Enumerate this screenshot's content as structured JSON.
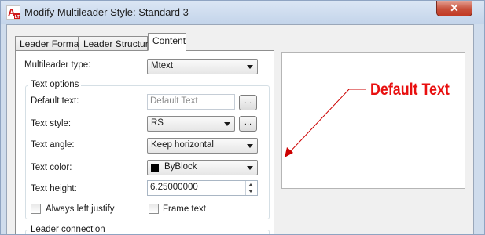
{
  "window": {
    "title": "Modify Multileader Style: Standard 3",
    "close_glyph": "✕",
    "app_icon": "autocad-lt-icon",
    "app_icon_text": "A"
  },
  "tabs": [
    {
      "label": "Leader Format",
      "active": false
    },
    {
      "label": "Leader Structure",
      "active": false
    },
    {
      "label": "Content",
      "active": true
    }
  ],
  "content": {
    "multileader_type": {
      "label": "Multileader type:",
      "value": "Mtext"
    },
    "text_options": {
      "title": "Text options",
      "default_text": {
        "label": "Default text:",
        "value": "Default Text",
        "button": "..."
      },
      "text_style": {
        "label": "Text style:",
        "value": "RS",
        "button": "..."
      },
      "text_angle": {
        "label": "Text angle:",
        "value": "Keep horizontal"
      },
      "text_color": {
        "label": "Text color:",
        "value": "ByBlock",
        "swatch": "#000000"
      },
      "text_height": {
        "label": "Text height:",
        "value": "6.25000000"
      },
      "always_left_justify": {
        "label": "Always left justify",
        "checked": false
      },
      "frame_text": {
        "label": "Frame text",
        "checked": false
      }
    },
    "leader_connection": {
      "title": "Leader connection"
    }
  },
  "preview": {
    "text": "Default Text",
    "text_color": "#e80f0f",
    "leader_color": "#cc0000"
  }
}
